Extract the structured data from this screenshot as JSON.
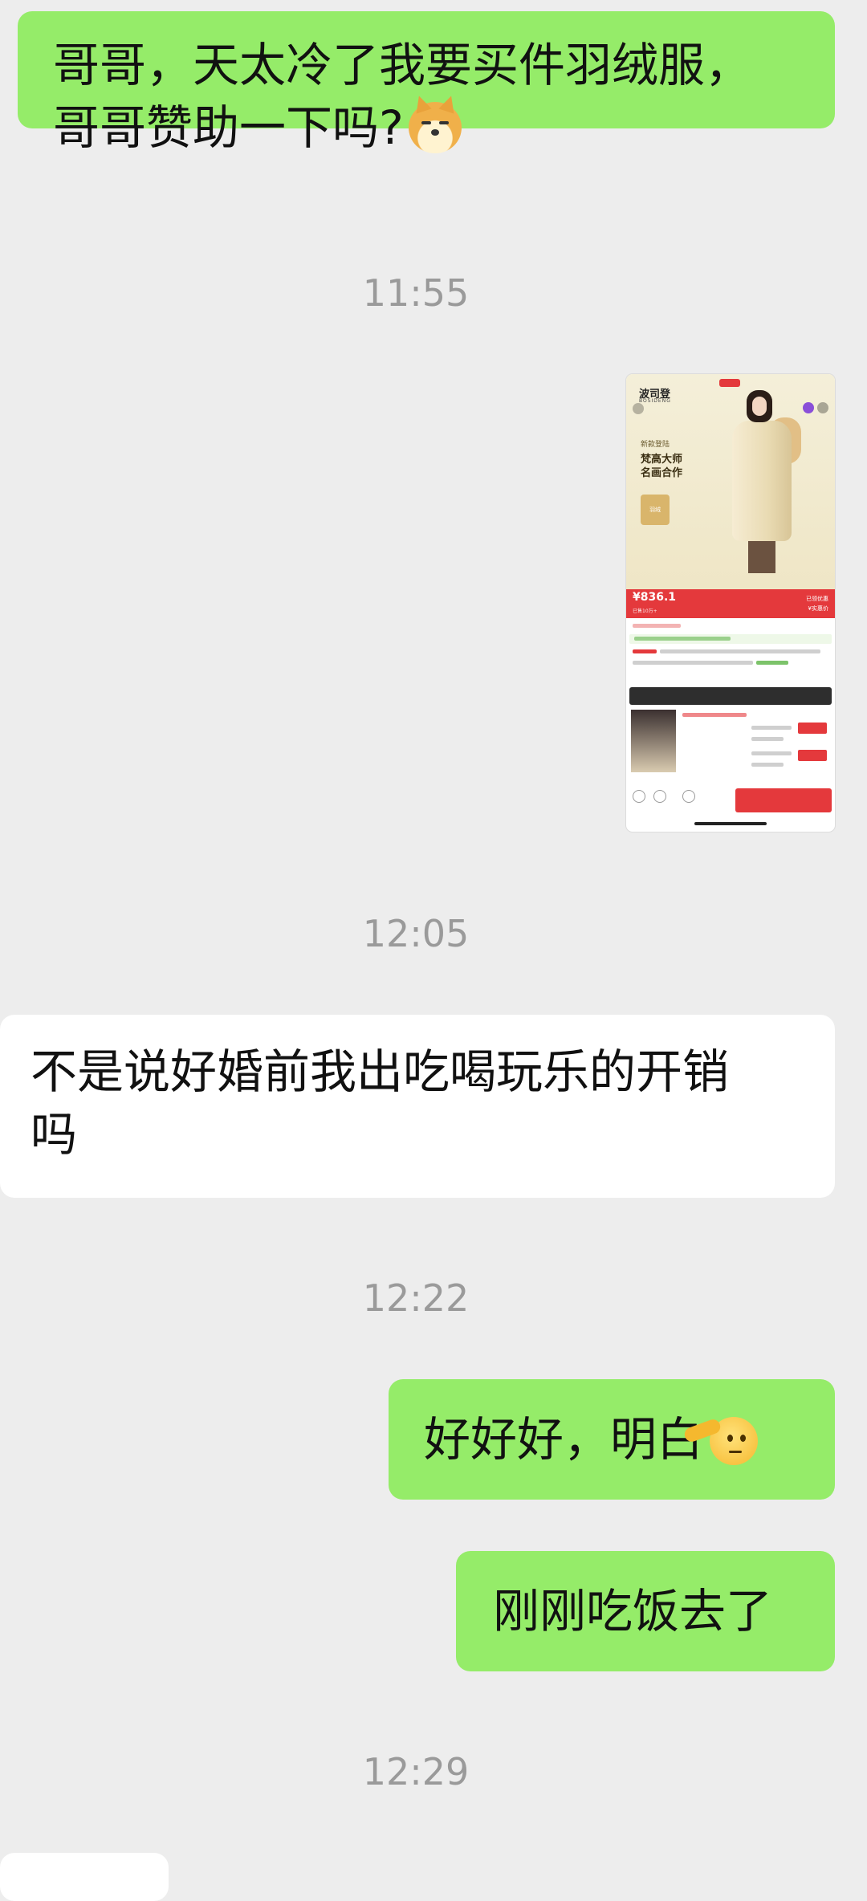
{
  "messages": [
    {
      "line1": "哥哥，天太冷了我要买件羽绒服，",
      "line2": "哥哥赞助一下吗?",
      "emoji": "shiba-dog-emoji"
    },
    {
      "timestamp": "11:55"
    },
    {
      "image": {
        "brand": "波司登",
        "brand_sub": "BOSIDENG",
        "subtag": "新款登陆",
        "headline_line1": "梵高大师",
        "headline_line2": "名画合作",
        "badge": "羽绒",
        "price": "¥836.1",
        "price_sub": "已售10万+",
        "right_top": "已领优惠",
        "right_bottom": "¥实惠价"
      }
    },
    {
      "timestamp": "12:05"
    },
    {
      "line1": "不是说好婚前我出吃喝玩乐的开销",
      "line2": "吗"
    },
    {
      "timestamp": "12:22"
    },
    {
      "text": "好好好，明白",
      "emoji": "salute-face-emoji"
    },
    {
      "text": "刚刚吃饭去了"
    },
    {
      "timestamp": "12:29"
    }
  ],
  "colors": {
    "background": "#ededed",
    "sent_bubble": "#95ec69",
    "received_bubble": "#ffffff",
    "timestamp_text": "#9a9a9a"
  }
}
